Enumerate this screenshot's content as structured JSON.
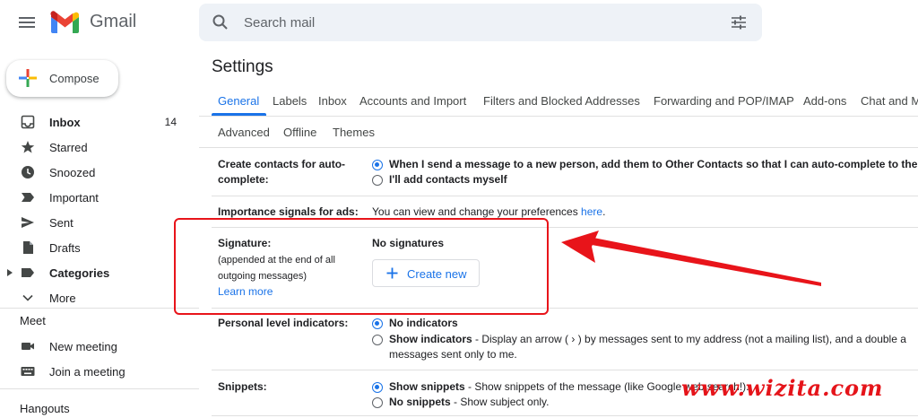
{
  "app": {
    "name": "Gmail"
  },
  "search": {
    "placeholder": "Search mail"
  },
  "compose": {
    "label": "Compose"
  },
  "sidebar": {
    "items": [
      {
        "label": "Inbox",
        "count": "14"
      },
      {
        "label": "Starred"
      },
      {
        "label": "Snoozed"
      },
      {
        "label": "Important"
      },
      {
        "label": "Sent"
      },
      {
        "label": "Drafts"
      },
      {
        "label": "Categories"
      },
      {
        "label": "More"
      }
    ],
    "meet": {
      "heading": "Meet",
      "items": [
        {
          "label": "New meeting"
        },
        {
          "label": "Join a meeting"
        }
      ]
    },
    "hangouts": {
      "heading": "Hangouts"
    }
  },
  "settings": {
    "title": "Settings",
    "tabs_row1": [
      "General",
      "Labels",
      "Inbox",
      "Accounts and Import",
      "Filters and Blocked Addresses",
      "Forwarding and POP/IMAP",
      "Add-ons",
      "Chat and M"
    ],
    "tabs_row2": [
      "Advanced",
      "Offline",
      "Themes"
    ],
    "active_tab": "General",
    "create_contacts": {
      "label_line1": "Create contacts for auto-",
      "label_line2": "complete:",
      "option1": "When I send a message to a new person, add them to Other Contacts so that I can auto-complete to them",
      "option2": "I'll add contacts myself"
    },
    "importance": {
      "label": "Importance signals for ads:",
      "text": "You can view and change your preferences ",
      "link": "here",
      "suffix": "."
    },
    "signature": {
      "label": "Signature:",
      "note_line1": "(appended at the end of all",
      "note_line2": "outgoing messages)",
      "learn_more": "Learn more",
      "status": "No signatures",
      "create_label": "Create new"
    },
    "personal_level": {
      "label": "Personal level indicators:",
      "option1": "No indicators",
      "option2_bold": "Show indicators",
      "option2_text": " - Display an arrow ( › ) by messages sent to my address (not a mailing list), and a double a",
      "option2_line2": "messages sent only to me."
    },
    "snippets": {
      "label": "Snippets:",
      "option1_bold": "Show snippets",
      "option1_text": " - Show snippets of the message (like Google web search!).",
      "option2_bold": "No snippets",
      "option2_text": " - Show subject only."
    }
  },
  "watermark": "www.wizita.com",
  "colors": {
    "accent": "#1a73e8",
    "highlight": "#e8141a"
  }
}
